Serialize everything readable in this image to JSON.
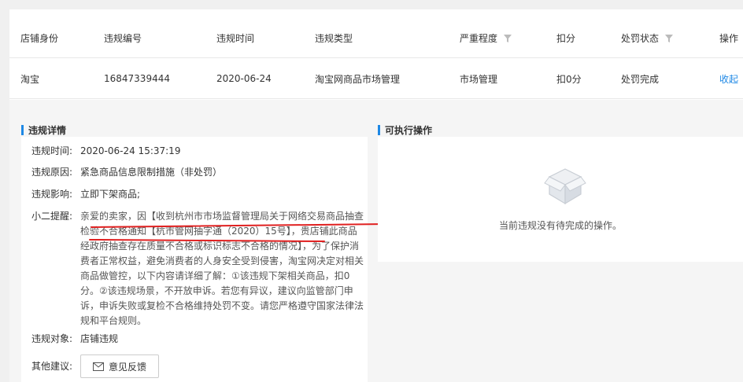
{
  "table": {
    "headers": {
      "store_identity": "店铺身份",
      "violation_id": "违规编号",
      "violation_time": "违规时间",
      "violation_type": "违规类型",
      "severity": "严重程度",
      "points": "扣分",
      "penalty_status": "处罚状态",
      "operation": "操作"
    },
    "row": {
      "store_identity": "淘宝",
      "violation_id": "16847339444",
      "violation_time": "2020-06-24",
      "violation_type": "淘宝网商品市场管理",
      "severity": "市场管理",
      "points": "扣0分",
      "penalty_status": "处罚完成",
      "operation": "收起"
    }
  },
  "detail": {
    "title": "违规详情",
    "time_label": "违规时间:",
    "time_value": "2020-06-24 15:37:19",
    "reason_label": "违规原因:",
    "reason_value": "紧急商品信息限制措施（非处罚）",
    "impact_label": "违规影响:",
    "impact_value": "立即下架商品;",
    "tip_label": "小二提醒:",
    "tip_value": "亲爱的卖家，因【收到杭州市市场监督管理局关于网络交易商品抽查检验不合格通知【杭市管网抽字通（2020）15号】，贵店铺此商品经政府抽查存在质量不合格或标识标志不合格的情况】，为了保护消费者正常权益，避免消费者的人身安全受到侵害，淘宝网决定对相关商品做管控，以下内容请详细了解：①该违规下架相关商品，扣0分。②该违规场景，不开放申诉。若您有异议，建议向监管部门申诉，申诉失败或复检不合格维持处罚不变。请您严格遵守国家法律法规和平台规则。",
    "object_label": "违规对象:",
    "object_value": "店铺违规",
    "other_label": "其他建议:",
    "feedback_button": "意见反馈"
  },
  "actions": {
    "title": "可执行操作",
    "empty_text": "当前违规没有待完成的操作。"
  },
  "colors": {
    "accent": "#1e88e5",
    "annotation": "#e02020"
  }
}
